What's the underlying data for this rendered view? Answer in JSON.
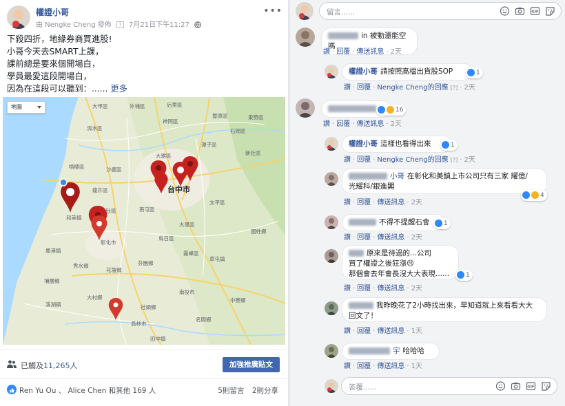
{
  "post": {
    "page_name": "權證小哥",
    "posted_by": "由 Nengke Cheng 發佈",
    "meta_help": "[?]",
    "timestamp": "7月21日下午11:27",
    "more_label": "•••",
    "body_lines": [
      "下殺四折，地緣券商買進股!",
      "小哥今天去SMART上課，",
      "課前總是要來個開場白，",
      "學員最愛這段開場白，"
    ],
    "last_line": "因為在這段可以聽到：......",
    "see_more": "更多",
    "reach_prefix": "已觸及",
    "reach_count": "11,265人",
    "boost_label": "加強推廣貼文",
    "reactions_text": "Ren Yu Ou 、 Alice Chen 和其他 169 人",
    "comment_count": "5則留言",
    "share_count": "2則分享"
  },
  "map": {
    "type_label": "地圖",
    "city_label": "台中市",
    "labels": [
      "潭子區",
      "豐原區",
      "神岡區",
      "大雅區",
      "清水區",
      "梧棲區",
      "沙鹿區",
      "龍井區",
      "大肚區",
      "南屯區",
      "大里區",
      "太平區",
      "霧峰區",
      "彰化市",
      "芬園鄉",
      "南投市",
      "鹿港鎮",
      "和美鎮",
      "員林市",
      "大村鄉",
      "花壇鄉",
      "秀水鄉",
      "埔鹽鄉",
      "溪湖鎮",
      "田中鎮",
      "社頭鄉",
      "草屯鎮",
      "中寮鄉",
      "名間鄉",
      "烏日區",
      "后里區",
      "外埔區",
      "大甲區",
      "東勢區",
      "新社區",
      "石岡區",
      "國姓鄉"
    ]
  },
  "composer": {
    "placeholder_top": "留言......",
    "placeholder_bottom": "答覆......"
  },
  "comments": [
    {
      "text": "in 被動還能空嗎",
      "actions": [
        "讚",
        "回覆",
        "傳送訊息"
      ],
      "time": "2天"
    },
    {
      "author": "權證小哥",
      "text": "請按照高檔出貨股SOP",
      "badge": "1",
      "actions": [
        "讚",
        "回覆",
        "Nengke Cheng的回應"
      ],
      "meta_help": "[?]",
      "time": "2天"
    },
    {
      "badge": "16",
      "actions": [
        "讚",
        "回覆",
        "傳送訊息"
      ],
      "time": "2天"
    },
    {
      "author": "權證小哥",
      "text": "這樣也看得出來",
      "badge": "1",
      "actions": [
        "讚",
        "回覆",
        "Nengke Cheng的回應"
      ],
      "meta_help": "[?]",
      "time": "2天"
    },
    {
      "text_name_suffix": "小哥",
      "text_l1": "在彰化和美鎮上市公司只有三家 耀億/",
      "text_l2": "光耀科/銀進閣",
      "badge": "4",
      "actions": [
        "讚",
        "回覆",
        "傳送訊息"
      ],
      "time": "2天"
    },
    {
      "text": "不得不提醒石會",
      "badge": "1",
      "actions": [
        "讚",
        "回覆",
        "傳送訊息"
      ],
      "time": "2天"
    },
    {
      "text_l1": "原來是待過的...公司",
      "text_l2": "買了權證之後狂漲😢",
      "text_l3": "那個會去年會長沒大大表現......",
      "badge": "1",
      "actions": [
        "讚",
        "回覆",
        "傳送訊息"
      ],
      "time": "2天"
    },
    {
      "text_l1": "我昨晚花了2小時找出來，早知道就上來看看大大",
      "text_l2": "回文了！",
      "actions": [
        "讚",
        "回覆",
        "傳送訊息"
      ],
      "time": "1天"
    },
    {
      "text_name_suffix": "宇",
      "text": "哈哈哈",
      "actions": [
        "讚",
        "回覆",
        "傳送訊息"
      ],
      "time": "1天"
    }
  ],
  "colors": {
    "accent": "#4267b2",
    "link": "#365899",
    "pin": "#c5221f",
    "like": "#2e89ff"
  },
  "icons": [
    "more-icon",
    "globe-icon",
    "reach-icon",
    "like-icon",
    "emoji-icon",
    "camera-icon",
    "gif-icon",
    "sticker-icon",
    "map-pin-icon"
  ]
}
